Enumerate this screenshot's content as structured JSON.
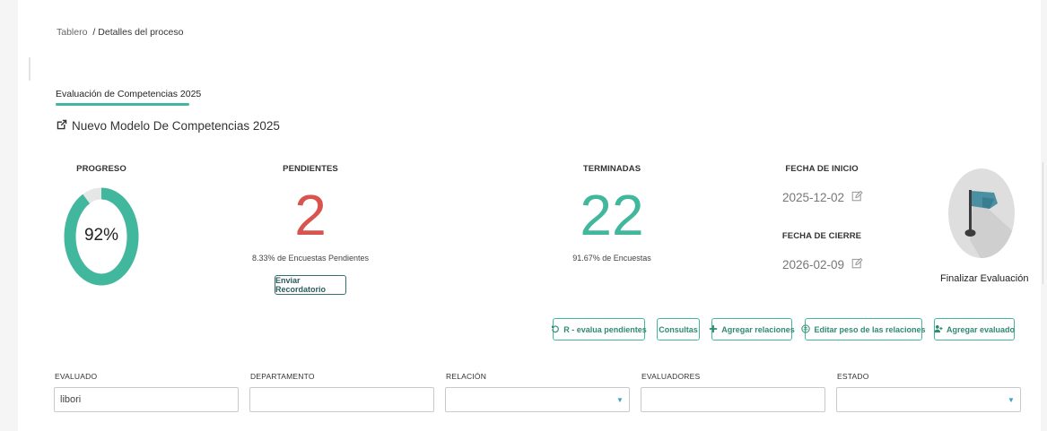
{
  "breadcrumb": {
    "home": "Tablero",
    "separator": "/",
    "current": "Detalles del proceso"
  },
  "tab": {
    "label": "Evaluación de Competencias 2025"
  },
  "model": {
    "title": "Nuevo Modelo De Competencias 2025",
    "icon": "external-link-icon"
  },
  "stats": {
    "progress": {
      "label": "PROGRESO",
      "value_text": "92%",
      "fraction": 0.92,
      "color": "#41b89d",
      "track_color": "#e6e6e6"
    },
    "pending": {
      "label": "PENDIENTES",
      "value": "2",
      "subtext": "8.33% de Encuestas Pendientes",
      "button": "Enviar Recordatorio",
      "color": "#d9534f"
    },
    "finished": {
      "label": "TERMINADAS",
      "value": "22",
      "subtext": "91.67% de Encuestas",
      "color": "#41b89d"
    },
    "start_date": {
      "label": "FECHA DE INICIO",
      "value": "2025-12-02",
      "icon": "edit-icon"
    },
    "end_date": {
      "label": "FECHA DE CIERRE",
      "value": "2026-02-09",
      "icon": "edit-icon"
    },
    "finalize": {
      "label": "Finalizar Evaluación",
      "icon": "flag-icon"
    }
  },
  "actions": {
    "re_evaluate": "R - evalua pendientes",
    "consults": "Consultas",
    "add_relations": "Agregar relaciones",
    "edit_weights": "Editar peso de las relaciones",
    "add_evaluated": "Agregar evaluado"
  },
  "filters": {
    "evaluated": {
      "label": "EVALUADO",
      "value": "libori"
    },
    "department": {
      "label": "DEPARTAMENTO",
      "value": ""
    },
    "relation": {
      "label": "RELACIÓN",
      "value": ""
    },
    "evaluators": {
      "label": "EVALUADORES",
      "value": ""
    },
    "status": {
      "label": "ESTADO",
      "value": ""
    }
  },
  "colors": {
    "accent": "#41b89d",
    "danger": "#d9534f",
    "dark_button": "#2d5b5e",
    "select_arrow": "#41a0c7"
  }
}
